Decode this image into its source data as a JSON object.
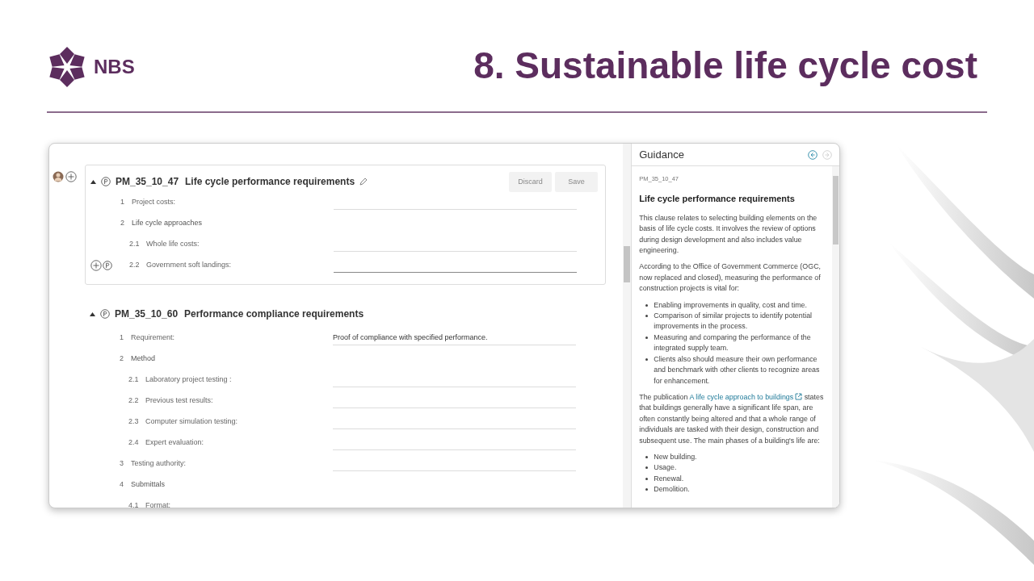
{
  "slide": {
    "logo_text": "NBS",
    "title": "8. Sustainable life cycle cost"
  },
  "editor": {
    "clauses": [
      {
        "code": "PM_35_10_47",
        "title": "Life cycle performance requirements",
        "editing": true,
        "buttons": [
          "Discard",
          "Save"
        ],
        "rows": [
          {
            "kind": "field",
            "number": "1",
            "label": "Project costs:",
            "focused": false
          },
          {
            "kind": "heading",
            "number": "2",
            "label": "Life cycle approaches",
            "children": [
              {
                "kind": "field",
                "number": "2.1",
                "label": "Whole life costs:",
                "focused": false
              },
              {
                "kind": "field",
                "number": "2.2",
                "label": "Government soft landings:",
                "focused": true
              }
            ]
          }
        ]
      },
      {
        "code": "PM_35_10_60",
        "title": "Performance compliance requirements",
        "editing": false,
        "rows": [
          {
            "kind": "field",
            "number": "1",
            "label": "Requirement:",
            "value": "Proof of compliance with specified performance.",
            "focused": false
          },
          {
            "kind": "heading",
            "number": "2",
            "label": "Method",
            "children": [
              {
                "kind": "field",
                "number": "2.1",
                "label": "Laboratory project testing :",
                "focused": false
              },
              {
                "kind": "field",
                "number": "2.2",
                "label": "Previous test results:",
                "focused": false
              },
              {
                "kind": "field",
                "number": "2.3",
                "label": "Computer simulation testing:",
                "focused": false
              },
              {
                "kind": "field",
                "number": "2.4",
                "label": "Expert evaluation:",
                "focused": false
              }
            ]
          },
          {
            "kind": "field",
            "number": "3",
            "label": "Testing authority:",
            "focused": false
          },
          {
            "kind": "heading",
            "number": "4",
            "label": "Submittals",
            "children": [
              {
                "kind": "label",
                "number": "4.1",
                "label": "Format:"
              }
            ]
          }
        ]
      }
    ]
  },
  "guidance": {
    "title": "Guidance",
    "nav_buttons": [
      {
        "kind": "back",
        "disabled": false
      },
      {
        "kind": "forward",
        "disabled": true
      }
    ],
    "code": "PM_35_10_47",
    "heading": "Life cycle performance requirements",
    "blocks": [
      {
        "kind": "paragraph",
        "text": "This clause relates to selecting building elements on the basis of life cycle costs. It involves the review of options during design development and also includes value engineering."
      },
      {
        "kind": "paragraph",
        "text": "According to the Office of Government Commerce (OGC, now replaced and closed), measuring the performance of construction projects is vital for:"
      },
      {
        "kind": "list",
        "items": [
          "Enabling improvements in quality, cost and time.",
          "Comparison of similar projects to identify potential improvements in the process.",
          "Measuring and comparing the performance of the integrated supply team.",
          "Clients also should measure their own performance and benchmark with other clients to recognize areas for enhancement."
        ]
      },
      {
        "kind": "link_paragraph",
        "before": "The publication",
        "link": "A life cycle approach to buildings",
        "after": "states that buildings generally have a significant life span, are often constantly being altered and that a whole range of individuals are tasked with their design, construction and subsequent use. The main phases of a building's life are:"
      },
      {
        "kind": "list",
        "items": [
          "New building.",
          "Usage.",
          "Renewal.",
          "Demolition."
        ]
      }
    ]
  }
}
